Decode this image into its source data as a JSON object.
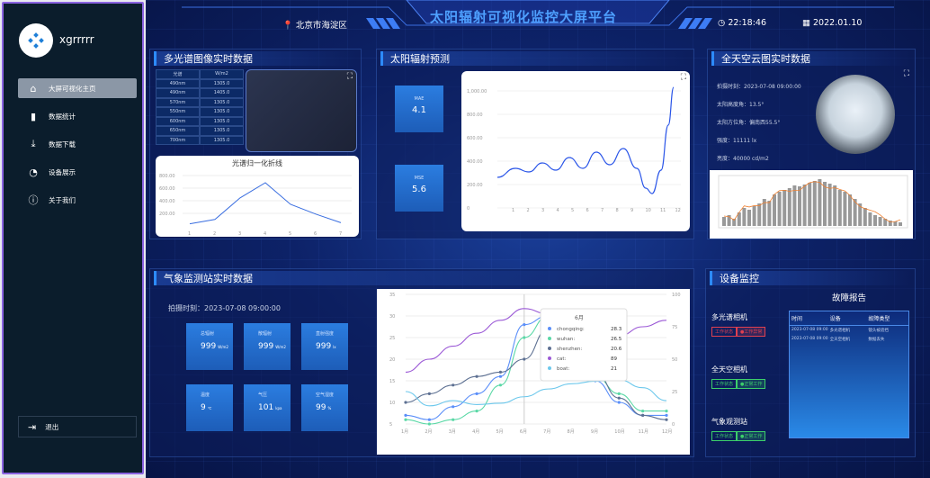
{
  "user": {
    "name": "xgrrrrr"
  },
  "sidebar": {
    "items": [
      {
        "label": "大屏可视化主页",
        "icon": "home-icon"
      },
      {
        "label": "数据统计",
        "icon": "bar-chart-icon"
      },
      {
        "label": "数据下载",
        "icon": "download-icon"
      },
      {
        "label": "设备展示",
        "icon": "gauge-icon"
      },
      {
        "label": "关于我们",
        "icon": "info-icon"
      }
    ],
    "logout": "退出"
  },
  "header": {
    "title": "太阳辐射可视化监控大屏平台",
    "location": "北京市海淀区",
    "time": "22:18:46",
    "date": "2022.01.10"
  },
  "spectral": {
    "title": "多光谱图像实时数据",
    "headers": [
      "光谱",
      "W/m2"
    ],
    "rows": [
      [
        "490nm",
        "1305.0"
      ],
      [
        "490nm",
        "1405.0"
      ],
      [
        "570nm",
        "1305.0"
      ],
      [
        "550nm",
        "1305.0"
      ],
      [
        "600nm",
        "1305.0"
      ],
      [
        "650nm",
        "1305.0"
      ],
      [
        "700nm",
        "1305.0"
      ]
    ],
    "line": {
      "title": "光谱归一化折线",
      "x": [
        "1",
        "2",
        "3",
        "4",
        "5",
        "6",
        "7"
      ],
      "yticks": [
        "800.00",
        "600.00",
        "400.00",
        "200.00"
      ]
    }
  },
  "forecast": {
    "title": "太阳辐射预测",
    "mae_label": "MAE",
    "mae": "4.1",
    "mse_label": "MSE",
    "mse": "5.6",
    "yticks": [
      "1,000.00",
      "800.00",
      "600.00",
      "400.00",
      "200.00",
      "0"
    ],
    "x": [
      "1",
      "2",
      "3",
      "4",
      "5",
      "6",
      "7",
      "8",
      "9",
      "10",
      "11",
      "12"
    ]
  },
  "sky": {
    "title": "全天空云图实时数据",
    "items": [
      "拍摄时刻：2023-07-08 09:00:00",
      "太阳高度角：13.5°",
      "太阳方位角：偏南西55.5°",
      "强度：11111 lx",
      "亮度：40000 cd/m2"
    ]
  },
  "weather": {
    "title": "气象监测站实时数据",
    "time": "拍摄时刻：2023-07-08 09:00:00",
    "cards": [
      {
        "label": "总辐射",
        "value": "999",
        "unit": "W/m2"
      },
      {
        "label": "散辐射",
        "value": "999",
        "unit": "W/m2"
      },
      {
        "label": "直射强度",
        "value": "999",
        "unit": "lx"
      },
      {
        "label": "温度",
        "value": "9",
        "unit": "℃"
      },
      {
        "label": "气压",
        "value": "101",
        "unit": "kpa"
      },
      {
        "label": "空气湿度",
        "value": "99",
        "unit": "%"
      }
    ]
  },
  "chart_data": {
    "type": "line",
    "categories": [
      "1月",
      "2月",
      "3月",
      "4月",
      "5月",
      "6月",
      "7月",
      "8月",
      "9月",
      "10月",
      "11月",
      "12月"
    ],
    "ylim": [
      5,
      35
    ],
    "y2lim": [
      0,
      100
    ],
    "yticks": [
      5,
      10,
      15,
      20,
      25,
      30,
      35
    ],
    "y2ticks": [
      0,
      25,
      50,
      75,
      100
    ],
    "series": [
      {
        "name": "chongqing",
        "color": "#5b8ff9",
        "values": [
          7,
          6,
          9,
          12,
          16,
          28,
          30,
          22,
          15,
          10,
          7,
          7
        ]
      },
      {
        "name": "wuhan",
        "color": "#5ad8a6",
        "values": [
          6,
          5,
          6,
          8,
          14,
          25,
          30,
          26,
          16,
          12,
          8,
          8
        ]
      },
      {
        "name": "shenzhen",
        "color": "#5d7092",
        "values": [
          10,
          12,
          14,
          16,
          17,
          20,
          27,
          24,
          17,
          11,
          7,
          6
        ]
      },
      {
        "name": "cat",
        "color": "#9b59d6",
        "axis": "right",
        "values": [
          40,
          50,
          60,
          70,
          80,
          89,
          85,
          78,
          62,
          68,
          75,
          80
        ]
      },
      {
        "name": "boat",
        "color": "#6dc8ec",
        "axis": "right",
        "values": [
          25,
          14,
          18,
          15,
          16,
          21,
          27,
          31,
          33,
          34,
          28,
          18
        ]
      }
    ],
    "tooltip": {
      "title": "6月",
      "rows": [
        [
          "chongqing:",
          "28.3"
        ],
        [
          "wuhan:",
          "26.5"
        ],
        [
          "shenzhen:",
          "20.6"
        ],
        [
          "cat:",
          "89"
        ],
        [
          "boat:",
          "21"
        ]
      ]
    }
  },
  "devices": {
    "title": "设备监控",
    "items": [
      {
        "name": "多光谱相机",
        "status1": "工作状态",
        "status2": "●工作异常",
        "warn": true
      },
      {
        "name": "全天空相机",
        "status1": "工作状态",
        "status2": "●正常工作",
        "warn": false
      },
      {
        "name": "气象观测站",
        "status1": "工作状态",
        "status2": "●正常工作",
        "warn": false
      }
    ],
    "report": {
      "title": "故障报告",
      "headers": [
        "时间",
        "设备",
        "故障类型"
      ],
      "rows": [
        [
          "2023-07-08 09:00",
          "多光谱相机",
          "镜头被遮挡"
        ],
        [
          "2023-07-08 09:00",
          "全天空相机",
          "数据丢失"
        ]
      ]
    }
  },
  "colors": {
    "accent": "#2d8bff",
    "sidebar": "#0b1d2c",
    "border": "#8a63e0"
  }
}
